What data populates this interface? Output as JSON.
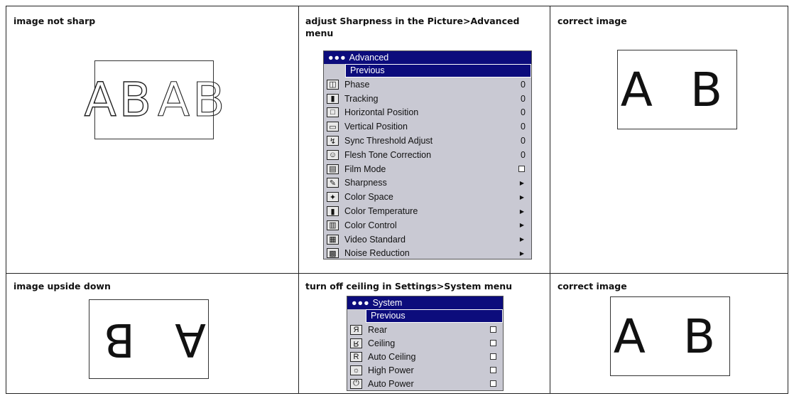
{
  "rows": [
    {
      "problem": "image not sharp",
      "solution": "adjust Sharpness in the Picture>Advanced menu",
      "result": "correct image",
      "sample_text": "AB",
      "result_text": "A B"
    },
    {
      "problem": "image upside down",
      "solution": "turn off ceiling in Settings>System menu",
      "result": "correct image",
      "sample_text": "A B",
      "result_text": "A B"
    }
  ],
  "advanced_menu": {
    "title": "Advanced",
    "previous": "Previous",
    "items": [
      {
        "label": "Phase",
        "icon": "phase-icon",
        "value": "0"
      },
      {
        "label": "Tracking",
        "icon": "tracking-icon",
        "value": "0"
      },
      {
        "label": "Horizontal Position",
        "icon": "horizontal-position-icon",
        "value": "0"
      },
      {
        "label": "Vertical Position",
        "icon": "vertical-position-icon",
        "value": "0"
      },
      {
        "label": "Sync Threshold Adjust",
        "icon": "sync-threshold-icon",
        "value": "0"
      },
      {
        "label": "Flesh Tone Correction",
        "icon": "flesh-tone-icon",
        "value": "0"
      },
      {
        "label": "Film Mode",
        "icon": "film-mode-icon",
        "value": "checkbox"
      },
      {
        "label": "Sharpness",
        "icon": "sharpness-icon",
        "value": "submenu"
      },
      {
        "label": "Color Space",
        "icon": "color-space-icon",
        "value": "submenu"
      },
      {
        "label": "Color Temperature",
        "icon": "color-temperature-icon",
        "value": "submenu"
      },
      {
        "label": "Color Control",
        "icon": "color-control-icon",
        "value": "submenu"
      },
      {
        "label": "Video Standard",
        "icon": "video-standard-icon",
        "value": "submenu"
      },
      {
        "label": "Noise Reduction",
        "icon": "noise-reduction-icon",
        "value": "submenu"
      }
    ]
  },
  "system_menu": {
    "title": "System",
    "previous": "Previous",
    "items": [
      {
        "label": "Rear",
        "icon": "rear-icon"
      },
      {
        "label": "Ceiling",
        "icon": "ceiling-icon"
      },
      {
        "label": "Auto Ceiling",
        "icon": "auto-ceiling-icon"
      },
      {
        "label": "High Power",
        "icon": "high-power-icon"
      },
      {
        "label": "Auto Power",
        "icon": "auto-power-icon"
      }
    ]
  },
  "colors": {
    "menu_header": "#0c0c7c",
    "menu_body": "#c9c9d3"
  }
}
